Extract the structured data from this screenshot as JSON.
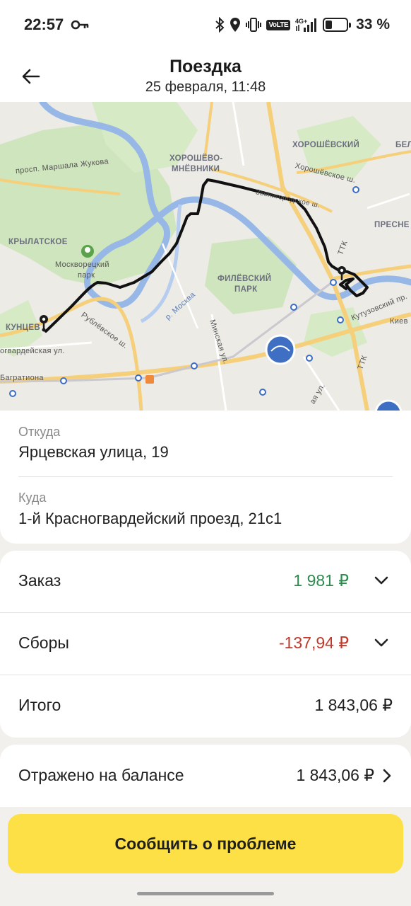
{
  "status_bar": {
    "time": "22:57",
    "battery": "33 %",
    "battery_level": 0.33,
    "network": "4G+",
    "volte": "VoLTE",
    "icons": [
      "key-icon",
      "bluetooth-icon",
      "location-icon",
      "vibrate-icon",
      "volte-icon",
      "signal-icon",
      "battery-icon"
    ]
  },
  "header": {
    "title": "Поездка",
    "subtitle": "25 февраля, 11:48",
    "back_icon": "arrow-left-icon"
  },
  "map": {
    "labels": {
      "khoroshevsky": "ХОРОШЁВСКИЙ",
      "khoroshevo1": "ХОРОШЁВО-",
      "khoroshevo2": "МНЁВНИКИ",
      "khoroshevo_sh": "Хорошёвское ш.",
      "zhukova": "просп. Маршала Жукова",
      "krylatskoe": "КРЫЛАТСКОЕ",
      "park1": "Москворецкий",
      "park2": "парк",
      "presnen": "ПРЕСНЕ",
      "bel": "БЕЛ",
      "ttk1": "ТТК",
      "ttk2": "ТТК",
      "filevsky1": "ФИЛЁВСКИЙ",
      "filevsky2": "ПАРК",
      "moskva": "р. Москва",
      "minskaya": "Минская ул.",
      "rublevskoe": "Рублёвское ш.",
      "kuntsevo": "КУНЦЕВ",
      "yartsevskaya": "огвардейская ул.",
      "bagrationa": "Багратиона",
      "kutuzovsky": "Кутузовский пр.",
      "kiev": "Киев",
      "zvenigorod": "Звенигородское ш.",
      "ul": "ая ул."
    },
    "colors": {
      "route": "#111111",
      "water": "#97b8e6",
      "park": "#cfe5bd",
      "road_major": "#f6cf7a",
      "road_minor": "#ffffff"
    }
  },
  "trip": {
    "from_label": "Откуда",
    "from_value": "Ярцевская улица, 19",
    "to_label": "Куда",
    "to_value": "1-й Красногвардейский проезд, 21с1"
  },
  "fare": {
    "order_label": "Заказ",
    "order_amount": "1 981 ₽",
    "order_color": "#2e8b4f",
    "fees_label": "Сборы",
    "fees_amount": "-137,94 ₽",
    "fees_color": "#c0392b",
    "total_label": "Итого",
    "total_amount": "1 843,06 ₽"
  },
  "balance": {
    "label": "Отражено на балансе",
    "amount": "1 843,06 ₽"
  },
  "actions": {
    "report_problem": "Сообщить о проблеме"
  }
}
